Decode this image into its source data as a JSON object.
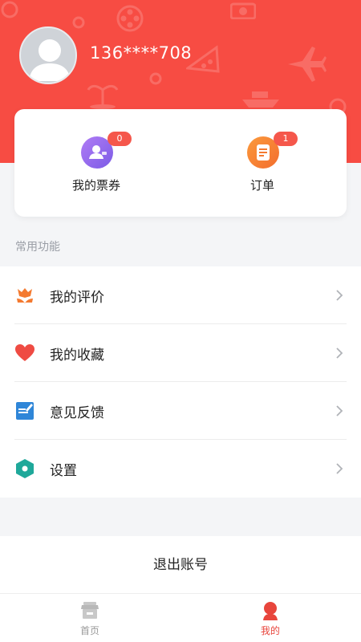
{
  "profile": {
    "phone": "136****708"
  },
  "summary": {
    "tickets": {
      "label": "我的票券",
      "count": "0",
      "icon": "ticket-user-icon"
    },
    "orders": {
      "label": "订单",
      "count": "1",
      "icon": "order-document-icon"
    }
  },
  "section": {
    "title": "常用功能"
  },
  "menu": {
    "items": [
      {
        "label": "我的评价",
        "icon": "flower-review-icon"
      },
      {
        "label": "我的收藏",
        "icon": "heart-icon"
      },
      {
        "label": "意见反馈",
        "icon": "feedback-edit-icon"
      },
      {
        "label": "设置",
        "icon": "hexagon-settings-icon"
      }
    ]
  },
  "logout": {
    "label": "退出账号"
  },
  "tabbar": {
    "items": [
      {
        "label": "首页",
        "icon": "shop-home-icon",
        "active": false
      },
      {
        "label": "我的",
        "icon": "person-icon",
        "active": true
      }
    ]
  },
  "colors": {
    "brand": "#f74c43",
    "badge": "#f5574b",
    "active_tab": "#e8453c",
    "inactive_tab": "#999999"
  }
}
